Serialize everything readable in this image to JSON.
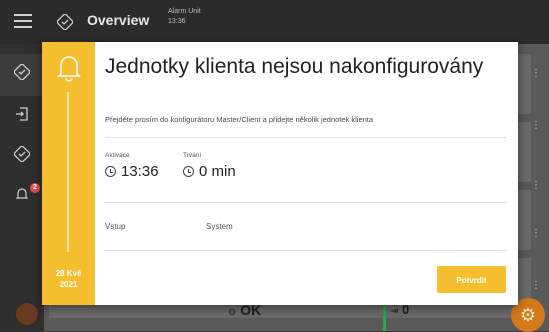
{
  "header": {
    "title": "Overview",
    "alarm_unit_label": "Alarm Unit",
    "alarm_unit_time": "13:36"
  },
  "sidebar": {
    "notification_count": "2"
  },
  "background": {
    "status_ok": "OK",
    "status_count": "0"
  },
  "modal": {
    "title": "Jednotky klienta nejsou nakonfigurovány",
    "subtitle": "Přejděte prosím do konfigurátoru Master/Client a přidejte několik jednotek klienta",
    "activation_label": "Aktivace",
    "activation_value": "13:36",
    "duration_label": "Trvání",
    "duration_value": "0 min",
    "input_label": "Vstup",
    "input_value": "System",
    "date_line1": "28 Kvě",
    "date_line2": "2021",
    "confirm_label": "Potvrdit"
  },
  "colors": {
    "accent": "#f5be2e",
    "badge": "#e05050",
    "status_green": "#2aa84a",
    "fab": "#d47a1c"
  },
  "icons": {
    "menu": "hamburger-icon",
    "overview": "overview-check-icon",
    "bell": "bell-icon",
    "clock": "clock-icon",
    "settings": "gear-icon"
  }
}
